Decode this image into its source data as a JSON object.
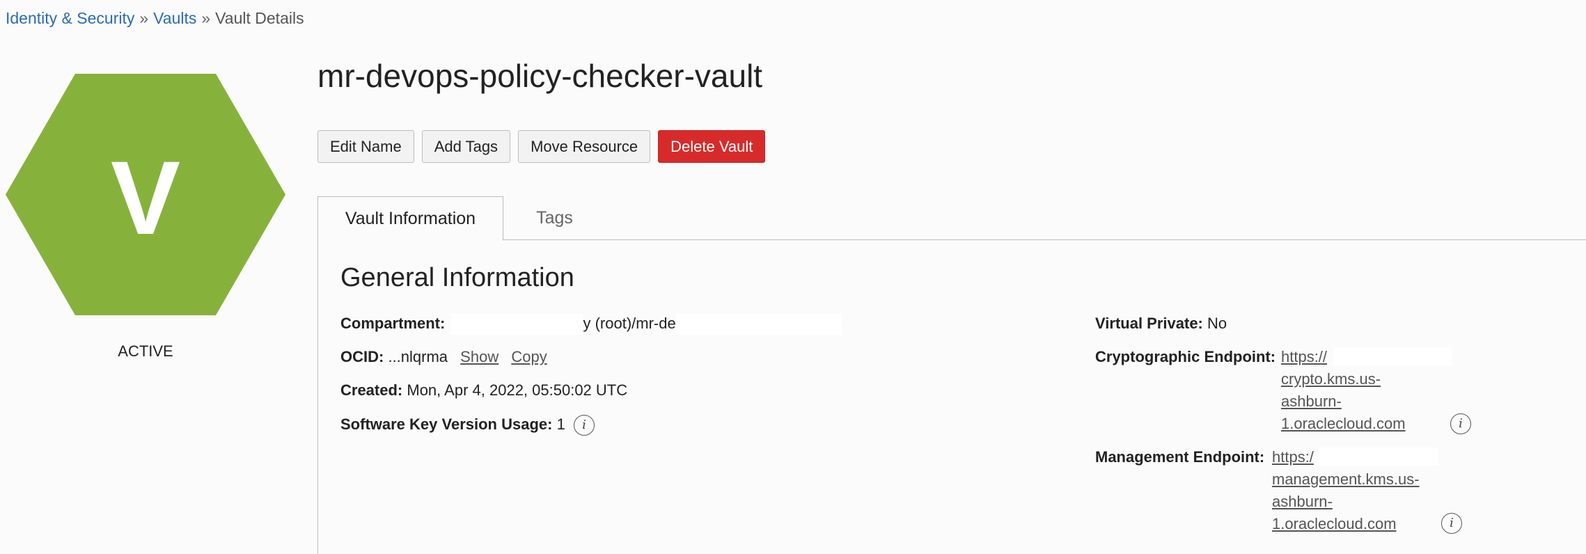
{
  "breadcrumb": {
    "items": [
      {
        "label": "Identity & Security"
      },
      {
        "label": "Vaults"
      }
    ],
    "separator": "»",
    "current": "Vault Details"
  },
  "resource": {
    "icon_letter": "V",
    "icon_color": "#86b23c",
    "status": "ACTIVE"
  },
  "page": {
    "title": "mr-devops-policy-checker-vault"
  },
  "actions": {
    "edit_name": "Edit Name",
    "add_tags": "Add Tags",
    "move_resource": "Move Resource",
    "delete_vault": "Delete Vault",
    "danger_color": "#d72b2b"
  },
  "tabs": {
    "vault_information": "Vault Information",
    "tags": "Tags"
  },
  "general": {
    "title": "General Information",
    "compartment": {
      "label": "Compartment:",
      "value": "y (root)/mr-de"
    },
    "ocid": {
      "label": "OCID:",
      "value": "...nlqrma",
      "show": "Show",
      "copy": "Copy"
    },
    "created": {
      "label": "Created:",
      "value": "Mon, Apr 4, 2022, 05:50:02 UTC"
    },
    "software_key_usage": {
      "label": "Software Key Version Usage:",
      "value": "1"
    },
    "virtual_private": {
      "label": "Virtual Private:",
      "value": "No"
    },
    "crypto_endpoint": {
      "label": "Cryptographic Endpoint:",
      "lines": [
        "https://",
        "crypto.kms.us-",
        "ashburn-",
        "1.oraclecloud.com"
      ]
    },
    "management_endpoint": {
      "label": "Management Endpoint:",
      "lines": [
        "https:/",
        "management.kms.us-",
        "ashburn-",
        "1.oraclecloud.com"
      ]
    }
  }
}
